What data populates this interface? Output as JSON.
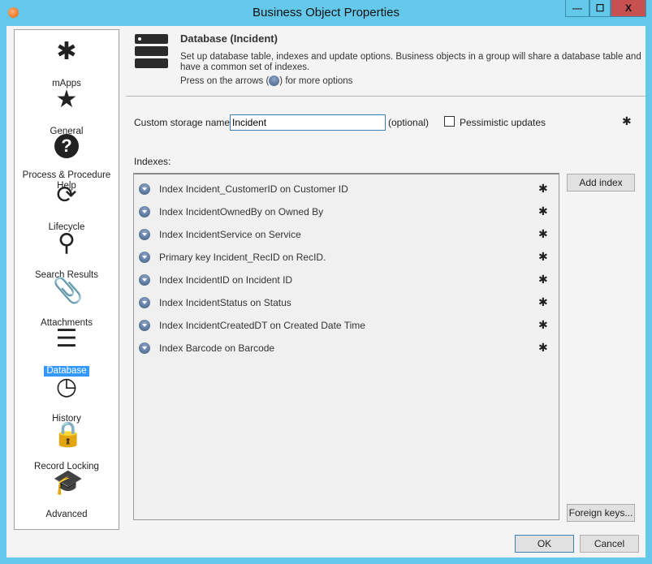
{
  "window": {
    "title": "Business Object Properties",
    "minimize": "—",
    "maximize": "☐",
    "close": "X"
  },
  "sidebar": {
    "items": [
      {
        "label": "mApps",
        "icon": "puzzle-icon"
      },
      {
        "label": "General",
        "icon": "star-icon"
      },
      {
        "label": "Process & Procedure Help",
        "icon": "help-icon"
      },
      {
        "label": "Lifecycle",
        "icon": "refresh-icon"
      },
      {
        "label": "Search Results",
        "icon": "search-icon"
      },
      {
        "label": "Attachments",
        "icon": "paperclip-icon"
      },
      {
        "label": "Database",
        "icon": "database-icon",
        "selected": true
      },
      {
        "label": "History",
        "icon": "history-icon"
      },
      {
        "label": "Record Locking",
        "icon": "lock-icon"
      },
      {
        "label": "Advanced",
        "icon": "graduation-cap-icon"
      }
    ]
  },
  "header": {
    "title": "Database  (Incident)",
    "description": "Set up database table, indexes and update options.  Business objects in a group will share a database table and have a common set of indexes.",
    "hint_before": "Press on the arrows (",
    "hint_after": ") for more options"
  },
  "storage": {
    "label": "Custom storage name:",
    "value": "Incident",
    "optional": "(optional)",
    "pessimistic_label": "Pessimistic updates",
    "pessimistic_checked": false
  },
  "indexes": {
    "label": "Indexes:",
    "items": [
      "Index Incident_CustomerID on Customer ID",
      "Index IncidentOwnedBy on Owned By",
      "Index IncidentService on Service",
      "Primary key Incident_RecID on RecID.",
      "Index IncidentID on Incident ID",
      "Index IncidentStatus on Status",
      "Index IncidentCreatedDT on Created Date Time",
      "Index Barcode on Barcode"
    ],
    "add_button": "Add index",
    "foreign_keys_button": "Foreign keys..."
  },
  "footer": {
    "ok": "OK",
    "cancel": "Cancel"
  },
  "colors": {
    "frame": "#64c8ea",
    "close": "#c75050",
    "selection": "#3399ff"
  }
}
